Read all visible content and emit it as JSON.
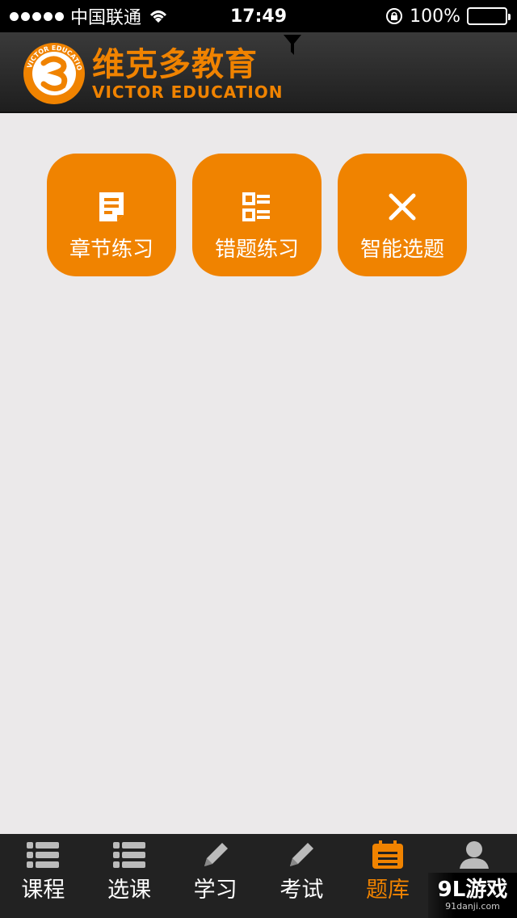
{
  "status_bar": {
    "carrier": "中国联通",
    "time": "17:49",
    "battery": "100%"
  },
  "header": {
    "brand_cn": "维克多教育",
    "brand_en": "VICTOR EDUCATION",
    "logo_ring_text": "VICTOR EDUCATION",
    "logo_icon": "victor-logo-icon",
    "filter_icon": "filter-icon"
  },
  "tiles": [
    {
      "label": "章节练习",
      "icon": "document-icon"
    },
    {
      "label": "错题练习",
      "icon": "list-icon"
    },
    {
      "label": "智能选题",
      "icon": "close-icon"
    }
  ],
  "tab_bar": {
    "items": [
      {
        "label": "课程",
        "icon": "list-icon"
      },
      {
        "label": "选课",
        "icon": "list-icon"
      },
      {
        "label": "学习",
        "icon": "pencil-icon"
      },
      {
        "label": "考试",
        "icon": "pencil-icon"
      },
      {
        "label": "题库",
        "icon": "calendar-icon",
        "active": true
      },
      {
        "label": "",
        "icon": "user-icon"
      }
    ]
  },
  "watermark": {
    "main": "9L游戏",
    "sub": "91danji.com"
  },
  "colors": {
    "accent": "#f08300",
    "background": "#ebe9ea",
    "header": "#2b2b2b",
    "tab_bar": "#222222"
  }
}
